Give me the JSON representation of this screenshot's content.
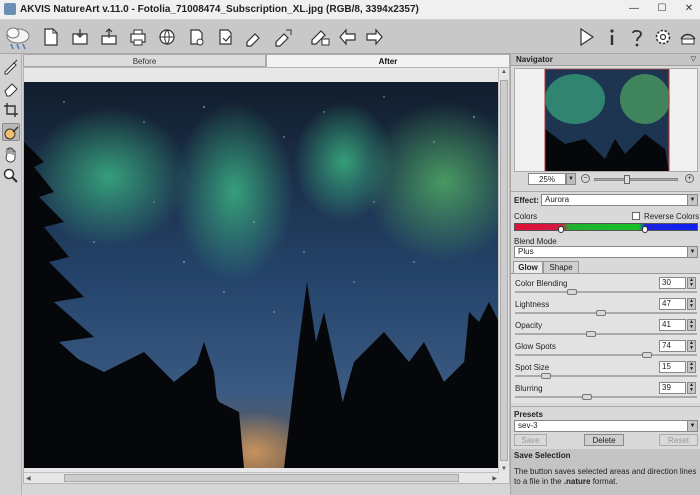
{
  "window": {
    "title": "AKVIS NatureArt v.11.0 - Fotolia_71008474_Subscription_XL.jpg (RGB/8, 3394x2357)",
    "minimize": "—",
    "maximize": "☐",
    "close": "✕"
  },
  "toolbar": {
    "left_buttons": [
      "open-icon",
      "save-icon",
      "export-icon",
      "print-icon",
      "share-icon",
      "batch-icon",
      "settings-file-icon",
      "load-strokes-icon",
      "save-strokes-icon",
      "brush-settings-icon",
      "undo-icon",
      "redo-icon"
    ],
    "right_buttons": [
      "run-icon",
      "info-icon",
      "help-icon",
      "gear-icon",
      "news-icon"
    ]
  },
  "left_tools": [
    "direction-tool-icon",
    "eraser-tool-icon",
    "crop-tool-icon",
    "selection-brush-icon",
    "hand-tool-icon",
    "zoom-tool-icon"
  ],
  "view_tabs": {
    "before": "Before",
    "after": "After"
  },
  "navigator": {
    "title": "Navigator",
    "zoom": "25%"
  },
  "effect": {
    "label": "Effect:",
    "value": "Aurora",
    "colors_label": "Colors",
    "reverse_colors_label": "Reverse Colors",
    "blend_mode_label": "Blend Mode",
    "blend_mode_value": "Plus"
  },
  "param_tabs": {
    "glow": "Glow",
    "shape": "Shape"
  },
  "params": [
    {
      "label": "Color Blending",
      "value": "30",
      "level": 0.3
    },
    {
      "label": "Lightness",
      "value": "47",
      "level": 0.47
    },
    {
      "label": "Opacity",
      "value": "41",
      "level": 0.41
    },
    {
      "label": "Glow Spots",
      "value": "74",
      "level": 0.74
    },
    {
      "label": "Spot Size",
      "value": "15",
      "level": 0.15
    },
    {
      "label": "Blurring",
      "value": "39",
      "level": 0.39
    }
  ],
  "presets": {
    "label": "Presets",
    "value": "sev-3",
    "save": "Save",
    "delete": "Delete",
    "reset": "Reset"
  },
  "save_selection": {
    "title": "Save Selection",
    "text_before": "The button saves selected areas and direction lines to a file in the ",
    "text_format": ".nature",
    "text_after": " format."
  },
  "colors": {
    "toolbar_bg": "#c8c8c8",
    "panel_bg": "#d9d9d9",
    "aurora_green": "#3fc48a",
    "sky_blue": "#2a4a6e"
  }
}
